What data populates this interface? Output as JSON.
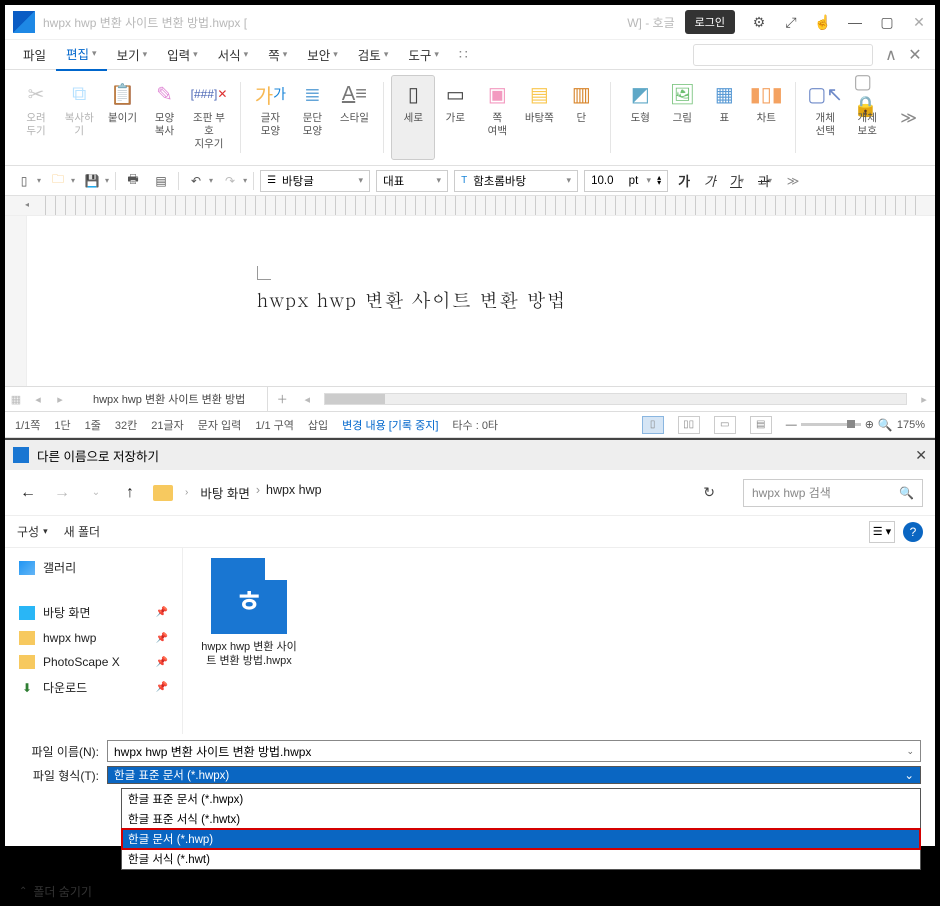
{
  "titlebar": {
    "filename": "hwpx hwp 변환 사이트 변환 방법.hwpx [",
    "suffix_note": "W] - 호글",
    "login": "로그인"
  },
  "menubar": {
    "file": "파일",
    "edit": "편집",
    "view": "보기",
    "input": "입력",
    "format": "서식",
    "page": "쪽",
    "security": "보안",
    "review": "검토",
    "tools": "도구",
    "search_placeholder": ""
  },
  "ribbon": {
    "cut": "오려\n두기",
    "copy": "복사하기",
    "paste": "붙이기",
    "shape_copy": "모양\n복사",
    "mark": "조판 부호\n지우기",
    "char_shape": "글자\n모양",
    "para_shape": "문단\n모양",
    "style": "스타일",
    "vertical": "세로",
    "horizontal": "가로",
    "page_margin": "쪽\n여백",
    "bg_page": "바탕쪽",
    "column": "단",
    "draw_shape": "도형",
    "picture": "그림",
    "table": "표",
    "chart": "차트",
    "obj_select": "개체\n선택",
    "obj_protect": "개체\n보호"
  },
  "toolbar": {
    "para_style": "바탕글",
    "rep": "대표",
    "font": "함초롬바탕",
    "size": "10.0",
    "unit": "pt"
  },
  "document": {
    "body_text": "hwpx hwp 변환 사이트 변환 방법"
  },
  "tabs": {
    "active": "hwpx hwp 변환 사이트 변환 방법"
  },
  "statusbar": {
    "page": "1/1쪽",
    "col": "1단",
    "line": "1줄",
    "pos": "32칸",
    "chars": "21글자",
    "mode": "문자 입력",
    "section": "1/1 구역",
    "insert": "삽입",
    "record": "변경 내용 [기록 중지]",
    "tab": "타수 : 0타",
    "zoom": "175%"
  },
  "dialog": {
    "title": "다른 이름으로 저장하기",
    "breadcrumb": [
      "바탕 화면",
      "hwpx hwp"
    ],
    "search_placeholder": "hwpx hwp 검색",
    "organize": "구성",
    "new_folder": "새 폴더",
    "side": {
      "gallery": "갤러리",
      "desktop": "바탕 화면",
      "folder": "hwpx hwp",
      "photoscape": "PhotoScape X",
      "downloads": "다운로드"
    },
    "file_item": "hwpx hwp 변환 사이트 변환 방법.hwpx",
    "filename_label": "파일 이름(N):",
    "filename_value": "hwpx hwp 변환 사이트 변환 방법.hwpx",
    "filetype_label": "파일 형식(T):",
    "filetype_value": "한글 표준 문서 (*.hwpx)",
    "options": {
      "hwpx": "한글 표준 문서 (*.hwpx)",
      "hwtx": "한글 표준 서식 (*.hwtx)",
      "hwp": "한글 문서 (*.hwp)",
      "hwt": "한글 서식 (*.hwt)"
    },
    "hide_folder": "폴더 숨기기"
  }
}
